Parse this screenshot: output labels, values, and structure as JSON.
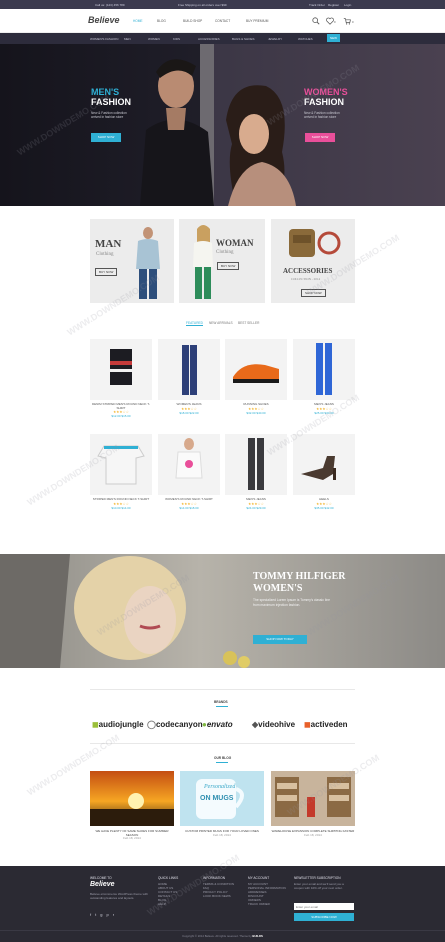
{
  "topbar": {
    "left1": "Call us: (123) 456 789",
    "left2": "Free Shipping on all orders over $99",
    "right1": "Track Order",
    "right2": "Register",
    "right3": "Login"
  },
  "header": {
    "logo": "Believe",
    "nav": [
      "HOME",
      "BLOG",
      "BUILD SHOP",
      "CONTACT",
      "BUY PREMIUM"
    ],
    "wishlist_count": "0",
    "cart_count": "0"
  },
  "catbar": [
    "WOMEN'S FASHION",
    "MEN",
    "WOMEN",
    "KIDS",
    "ACCESSORIES",
    "BAGS & SHOES",
    "JEWELRY",
    "WATCHES",
    "CLEARANCE"
  ],
  "catbar_badge": "NEW",
  "hero": {
    "men_title_1": "MEN'S",
    "men_title_2": "FASHION",
    "men_text": "New & Fashion collection arrived in fashion store",
    "men_btn": "SHOP NOW",
    "women_title_1": "WOMEN'S",
    "women_title_2": "FASHION",
    "women_text": "New & Fashion collection arrived in fashion store",
    "women_btn": "SHOP NOW"
  },
  "categories": {
    "man_title": "MAN",
    "man_sub": "Clothing",
    "man_btn": "BUY NOW",
    "woman_title": "WOMAN",
    "woman_sub": "Clothing",
    "woman_btn": "BUY NOW",
    "acc_title": "ACCESSORIES",
    "acc_sub": "COLLECTION - 2014",
    "acc_btn": "SHOP NOW"
  },
  "tabs": [
    "FEATURED",
    "NEW ARRIVALS",
    "BEST SELLER"
  ],
  "products": [
    {
      "name": "DENIM STRIPED MEN'S ROUND NECK T-SHIRT",
      "stars": "★★★☆☆",
      "price": "$12.00 $15.00"
    },
    {
      "name": "WOMEN'S JEANS",
      "stars": "★★★☆☆",
      "price": "$18.00 $22.00"
    },
    {
      "name": "RUNNING SHOES",
      "stars": "★★★☆☆",
      "price": "$32.00 $40.00"
    },
    {
      "name": "MEN'S JEANS",
      "stars": "★★★☆☆",
      "price": "$25.00 $30.00"
    },
    {
      "name": "STRIPED MEN'S ROUND NECK T-SHIRT",
      "stars": "★★★☆☆",
      "price": "$10.00 $14.00"
    },
    {
      "name": "WOMEN'S ROUND NECK T-SHIRT",
      "stars": "★★★☆☆",
      "price": "$14.00 $18.00"
    },
    {
      "name": "MEN'S JEANS",
      "stars": "★★★☆☆",
      "price": "$24.00 $29.00"
    },
    {
      "name": "HEELS",
      "stars": "★★★☆☆",
      "price": "$35.00 $42.00"
    }
  ],
  "banner": {
    "title_1": "TOMMY HILFIGER",
    "title_2": "WOMEN'S",
    "text": "The specialized Lorem Ipsum is Tommy's classic line from maximum injection fashion.",
    "btn": "SHOP NOW TODAY"
  },
  "brands": {
    "heading": "BRANDS",
    "items": [
      "audiojungle",
      "codecanyon",
      "envato",
      "videohive",
      "activeden"
    ]
  },
  "blog": {
    "heading": "OUR BLOG",
    "mug_text_1": "Personalized",
    "mug_text_2": "ON MUGS",
    "posts": [
      {
        "title": "WE HAVE PLENTY OF SAME SHOES FOR SUMMER SEASON",
        "meta": "Feb 18, 2014"
      },
      {
        "title": "CUSTOM PRINTED MUGS FOR YOUR LOVED ONES",
        "meta": "Feb 18, 2014"
      },
      {
        "title": "WAREHOUSE EXPANSION COMPLETE SHIPPING FASTER",
        "meta": "Feb 18, 2014"
      }
    ]
  },
  "footer": {
    "logo": "Believe",
    "about_heading": "WELCOME TO",
    "about_text": "Believe eCommerce WordPress theme with outstanding features and layouts.",
    "col1_heading": "QUICK LINKS",
    "col1": [
      "HOME",
      "ABOUT US",
      "CONTACT US",
      "DETAILS",
      "BLOG",
      "HELP"
    ],
    "col2_heading": "INFORMATION",
    "col2": [
      "TERMS & CONDITION",
      "FAQ",
      "PRIVACY POLICY",
      "LOOK BOOK NEWS"
    ],
    "col3_heading": "MY ACCOUNT",
    "col3": [
      "MY ACCOUNT",
      "PERSONAL INFORMATION",
      "ADDRESSES",
      "DISCOUNT",
      "ORDERS",
      "TRACK ORDER"
    ],
    "news_heading": "NEWSLETTER SUBSCRIPTION",
    "news_text": "Enter your email and we'll send you a coupon with 10% off your next order.",
    "news_placeholder": "Enter your email",
    "news_btn": "SUBSCRIBE NOW",
    "copyright": "Copyright © 2014 Believe. All rights reserved. Theme by",
    "copyright_brand": "BUILDS"
  },
  "watermark": "WWW.DOWNDEMO.COM",
  "colors": {
    "accent": "#2fb0d4",
    "pink": "#e94f9a",
    "dark": "#2b2a33"
  }
}
